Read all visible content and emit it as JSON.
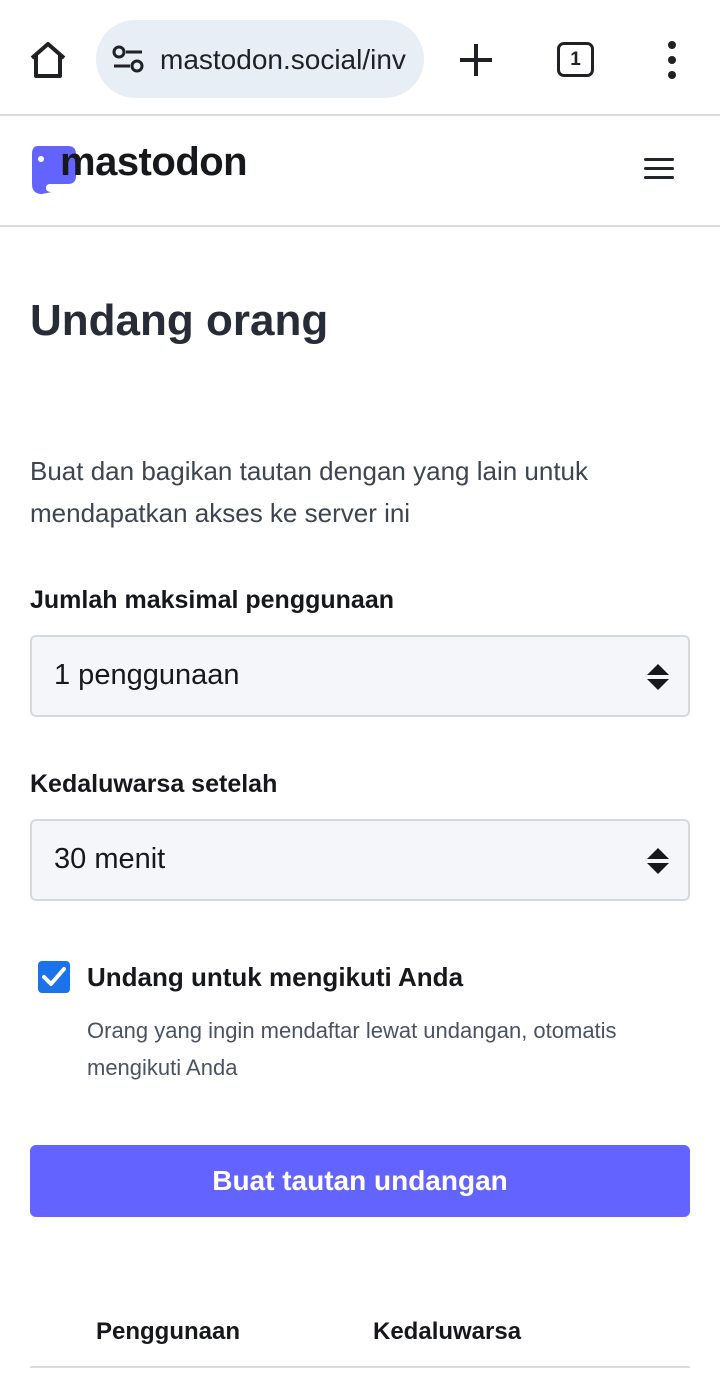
{
  "browser": {
    "url": "mastodon.social/inv",
    "tab_count": "1"
  },
  "site": {
    "logo_text": "mastodon"
  },
  "page": {
    "title": "Undang orang",
    "intro": "Buat dan bagikan tautan dengan yang lain untuk mendapatkan akses ke server ini"
  },
  "form": {
    "max_uses": {
      "label": "Jumlah maksimal penggunaan",
      "value": "1 penggunaan"
    },
    "expires": {
      "label": "Kedaluwarsa setelah",
      "value": "30 menit"
    },
    "autofollow": {
      "checked": true,
      "label": "Undang untuk mengikuti Anda",
      "hint": "Orang yang ingin mendaftar lewat undangan, otomatis mengikuti Anda"
    },
    "submit_label": "Buat tautan undangan"
  },
  "table": {
    "headers": [
      "Penggunaan",
      "Kedaluwarsa"
    ]
  },
  "colors": {
    "brand": "#6364ff",
    "checkbox": "#1a73e8"
  },
  "icons": {
    "home": "home-icon",
    "site_info": "tune-icon",
    "new_tab": "plus-icon",
    "menu": "more-vert-icon",
    "hamburger": "hamburger-icon",
    "select_arrows": "sort-arrows-icon",
    "check": "check-icon"
  }
}
